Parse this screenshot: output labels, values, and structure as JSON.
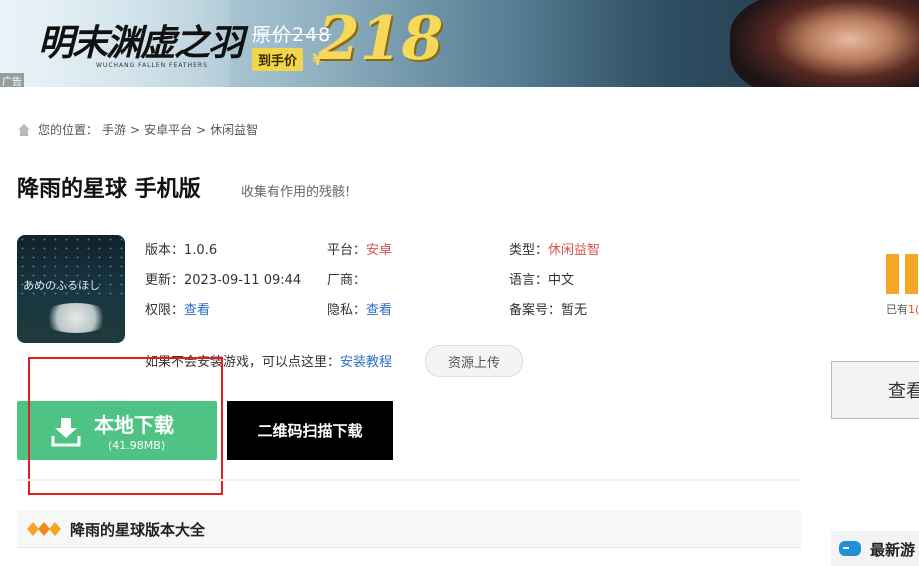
{
  "banner": {
    "logo_text": "明末渊虚之羽",
    "logo_sub": "WUCHANG FALLEN FEATHERS",
    "original_price": "原价248",
    "price_tag": "到手价",
    "currency": "¥",
    "sale_price": "218",
    "ad_label": "广告"
  },
  "breadcrumb": {
    "prefix": "您的位置：",
    "items": [
      "手游",
      "安卓平台",
      "休闲益智"
    ],
    "sep": ">"
  },
  "app": {
    "title": "降雨的星球 手机版",
    "subtitle": "收集有作用的残骸!",
    "icon_text": "あめのふるほし",
    "version_label": "版本：",
    "version": "1.0.6",
    "platform_label": "平台：",
    "platform": "安卓",
    "type_label": "类型：",
    "type": "休闲益智",
    "updated_label": "更新：",
    "updated": "2023-09-11 09:44",
    "vendor_label": "厂商：",
    "vendor": "",
    "language_label": "语言：",
    "language": "中文",
    "permission_label": "权限：",
    "permission_link": "查看",
    "privacy_label": "隐私：",
    "privacy_link": "查看",
    "record_label": "备案号：",
    "record": "暂无"
  },
  "tip": {
    "text": "如果不会安装游戏，可以点这里：",
    "link": "安装教程",
    "upload_button": "资源上传"
  },
  "download": {
    "local_label": "本地下载",
    "local_size": "(41.98MB)",
    "qr_label": "二维码扫描下载"
  },
  "section": {
    "title": "降雨的星球版本大全"
  },
  "right": {
    "count_prefix": "已有",
    "count_value": "1(",
    "view_button": "查看",
    "newest_title": "最新游"
  },
  "colors": {
    "green": "#4fc383",
    "red_text": "#d9534f",
    "link_blue": "#2a6fc9",
    "annotation_red": "#e02020",
    "orange": "#f5a623"
  }
}
